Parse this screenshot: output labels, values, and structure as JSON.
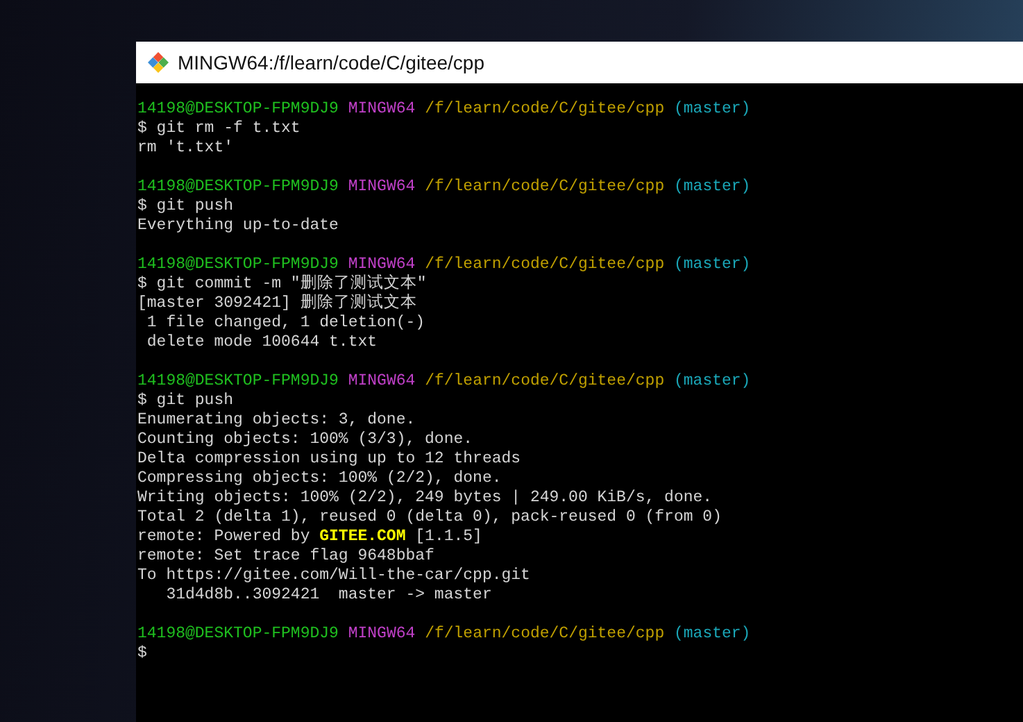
{
  "window": {
    "title": "MINGW64:/f/learn/code/C/gitee/cpp"
  },
  "terminal": {
    "lines": [
      {
        "kind": "prompt",
        "user": "14198@DESKTOP-FPM9DJ9",
        "shell": "MINGW64",
        "path": "/f/learn/code/C/gitee/cpp",
        "branch": "(master)"
      },
      {
        "kind": "command",
        "text": "$ git rm -f t.txt"
      },
      {
        "kind": "output",
        "text": "rm 't.txt'"
      },
      {
        "kind": "blank"
      },
      {
        "kind": "prompt",
        "user": "14198@DESKTOP-FPM9DJ9",
        "shell": "MINGW64",
        "path": "/f/learn/code/C/gitee/cpp",
        "branch": "(master)"
      },
      {
        "kind": "command",
        "text": "$ git push"
      },
      {
        "kind": "output",
        "text": "Everything up-to-date"
      },
      {
        "kind": "blank"
      },
      {
        "kind": "prompt",
        "user": "14198@DESKTOP-FPM9DJ9",
        "shell": "MINGW64",
        "path": "/f/learn/code/C/gitee/cpp",
        "branch": "(master)"
      },
      {
        "kind": "command",
        "text": "$ git commit -m \"删除了测试文本\""
      },
      {
        "kind": "output",
        "text": "[master 3092421] 删除了测试文本"
      },
      {
        "kind": "output",
        "text": " 1 file changed, 1 deletion(-)"
      },
      {
        "kind": "output",
        "text": " delete mode 100644 t.txt"
      },
      {
        "kind": "blank"
      },
      {
        "kind": "prompt",
        "user": "14198@DESKTOP-FPM9DJ9",
        "shell": "MINGW64",
        "path": "/f/learn/code/C/gitee/cpp",
        "branch": "(master)"
      },
      {
        "kind": "command",
        "text": "$ git push"
      },
      {
        "kind": "output",
        "text": "Enumerating objects: 3, done."
      },
      {
        "kind": "output",
        "text": "Counting objects: 100% (3/3), done."
      },
      {
        "kind": "output",
        "text": "Delta compression using up to 12 threads"
      },
      {
        "kind": "output",
        "text": "Compressing objects: 100% (2/2), done."
      },
      {
        "kind": "output",
        "text": "Writing objects: 100% (2/2), 249 bytes | 249.00 KiB/s, done."
      },
      {
        "kind": "output",
        "text": "Total 2 (delta 1), reused 0 (delta 0), pack-reused 0 (from 0)"
      },
      {
        "kind": "highlighted",
        "before": "remote: Powered by ",
        "highlight": "GITEE.COM",
        "after": " [1.1.5]"
      },
      {
        "kind": "output",
        "text": "remote: Set trace flag 9648bbaf"
      },
      {
        "kind": "output",
        "text": "To https://gitee.com/Will-the-car/cpp.git"
      },
      {
        "kind": "output",
        "text": "   31d4d8b..3092421  master -> master"
      },
      {
        "kind": "blank"
      },
      {
        "kind": "prompt",
        "user": "14198@DESKTOP-FPM9DJ9",
        "shell": "MINGW64",
        "path": "/f/learn/code/C/gitee/cpp",
        "branch": "(master)"
      },
      {
        "kind": "command",
        "text": "$"
      }
    ]
  }
}
